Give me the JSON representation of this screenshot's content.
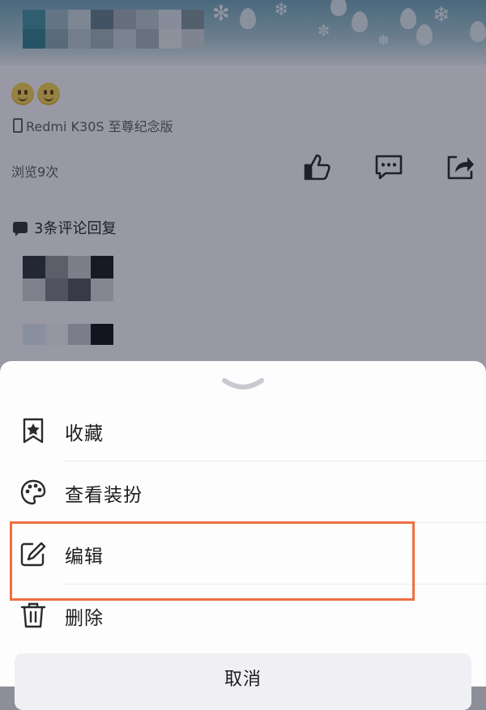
{
  "post": {
    "device_label": "Redmi K30S 至尊纪念版",
    "views_label": "浏览9次",
    "comments_header": "3条评论回复"
  },
  "sheet": {
    "items": [
      {
        "label": "收藏",
        "icon": "bookmark-star-icon"
      },
      {
        "label": "查看装扮",
        "icon": "palette-icon"
      },
      {
        "label": "编辑",
        "icon": "edit-icon"
      },
      {
        "label": "删除",
        "icon": "trash-icon"
      }
    ],
    "cancel_label": "取消",
    "handle_icon": "chevron-down-icon"
  },
  "annotation": {
    "highlight_color": "#ef6f43",
    "highlighted_item": "编辑"
  }
}
